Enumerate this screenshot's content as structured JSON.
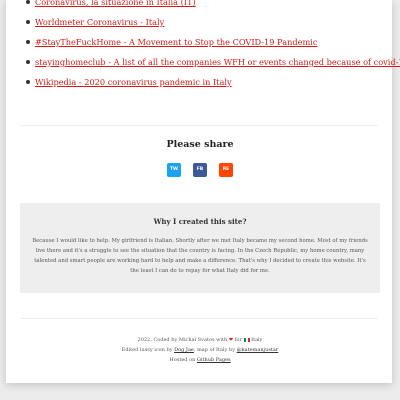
{
  "links": [
    {
      "label": "Coronavirus, la situazione in Italia (IT)"
    },
    {
      "label": "Worldmeter Coronavirus - Italy"
    },
    {
      "label": "#StayTheFuckHome - A Movement to Stop the COVID-19 Pandemic"
    },
    {
      "label": "stayinghomeclub - A list of all the companies WFH or events changed because of covid-19"
    },
    {
      "label": "Wikipedia - 2020 coronavirus pandemic in Italy"
    }
  ],
  "share": {
    "title": "Please share",
    "buttons": [
      {
        "label": "TW",
        "color": "#1da1f2"
      },
      {
        "label": "FB",
        "color": "#3b5998"
      },
      {
        "label": "RE",
        "color": "#ff4500"
      }
    ]
  },
  "why": {
    "title": "Why I created this site?",
    "text": "Because I would like to help. My girlfriend is Italian. Shortly after we met Italy became my second home. Most of my friends live there and it's a struggle to see the situation that the country is facing. In the Czech Republic, my home country, many talented and smart people are working hard to help and make a difference. That's why I decided to create this website. It's the least I can do to repay for what Italy did for me."
  },
  "footer": {
    "line1_pre": "2022, Coded by Michal Svatos with",
    "line1_mid": "for",
    "line1_post": "Italy",
    "line2_pre": "Edited lussy icon by",
    "line2_link1": "Dog Jae",
    "line2_mid": ", map of Italy by",
    "line2_link2": "@katemanjustar",
    "line3_pre": "Hosted on",
    "line3_link": "Github Pages"
  },
  "colors": {
    "link": "#d21b1b",
    "accent_heart": "#d21b1b",
    "why_bg": "#eeeeee"
  }
}
